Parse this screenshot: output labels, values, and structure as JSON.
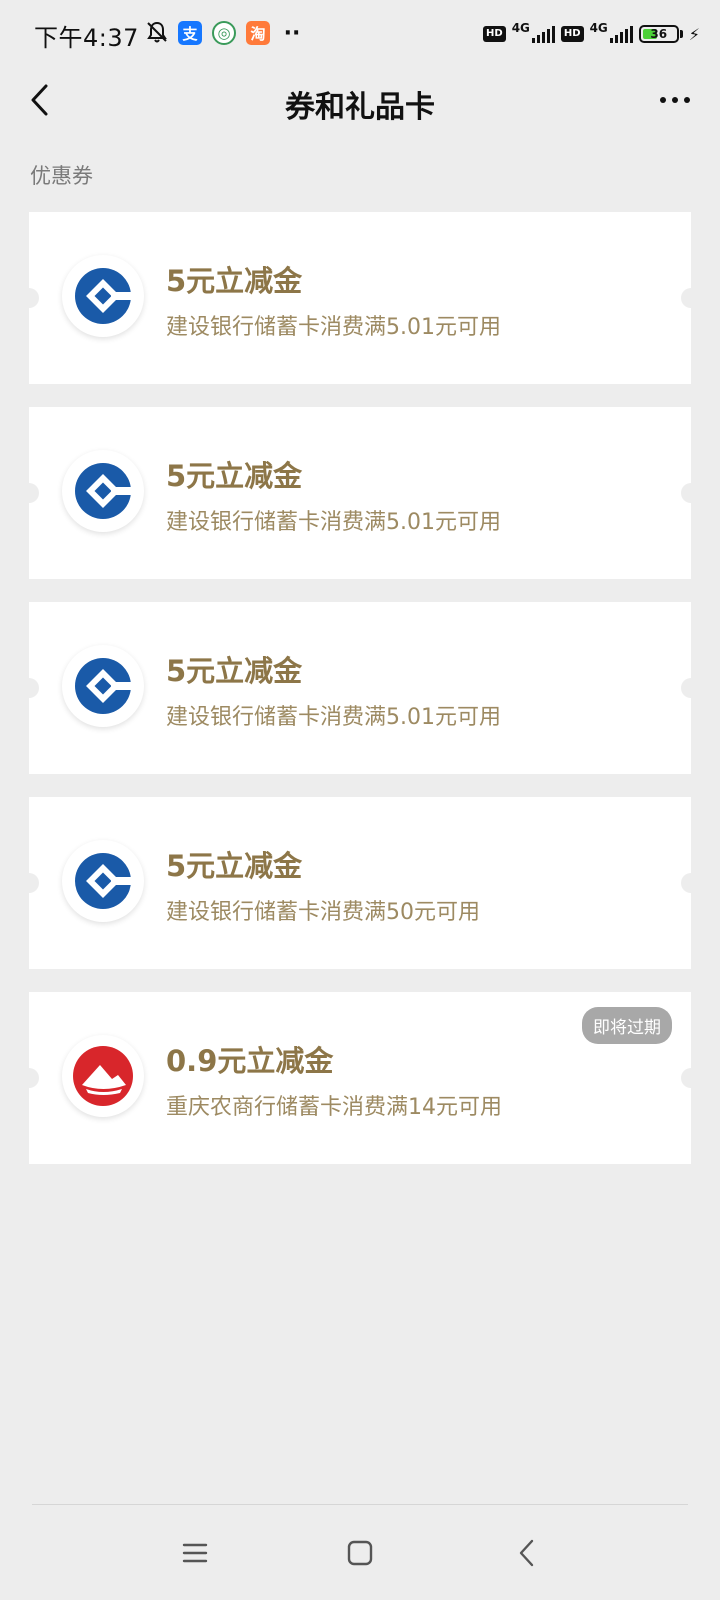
{
  "status_bar": {
    "time": "下午4:37",
    "network1": "4G",
    "network2": "4G",
    "hd1": "HD",
    "hd2": "HD",
    "battery": "36",
    "battery_fraction": 0.36,
    "app_icons": [
      {
        "name": "alipay-icon",
        "glyph": "支",
        "color": "#1677ff"
      },
      {
        "name": "app-green-icon",
        "glyph": "◎",
        "color": "#3a9a5a"
      },
      {
        "name": "taobao-icon",
        "glyph": "淘",
        "color": "#ff7a3a"
      }
    ]
  },
  "header": {
    "title": "券和礼品卡"
  },
  "section": {
    "label": "优惠券"
  },
  "coupons": [
    {
      "title": "5元立减金",
      "desc": "建设银行储蓄卡消费满5.01元可用",
      "bank": "ccb",
      "badge": ""
    },
    {
      "title": "5元立减金",
      "desc": "建设银行储蓄卡消费满5.01元可用",
      "bank": "ccb",
      "badge": ""
    },
    {
      "title": "5元立减金",
      "desc": "建设银行储蓄卡消费满5.01元可用",
      "bank": "ccb",
      "badge": ""
    },
    {
      "title": "5元立减金",
      "desc": "建设银行储蓄卡消费满50元可用",
      "bank": "ccb",
      "badge": ""
    },
    {
      "title": "0.9元立减金",
      "desc": "重庆农商行储蓄卡消费满14元可用",
      "bank": "cqrcb",
      "badge": "即将过期"
    }
  ],
  "colors": {
    "background": "#ededed",
    "coupon_title": "#8d7648",
    "coupon_desc": "#9d8a62",
    "ccb_blue": "#1a5aa8",
    "cqrcb_red": "#d8262b",
    "badge_gray": "#a8a8a8"
  }
}
